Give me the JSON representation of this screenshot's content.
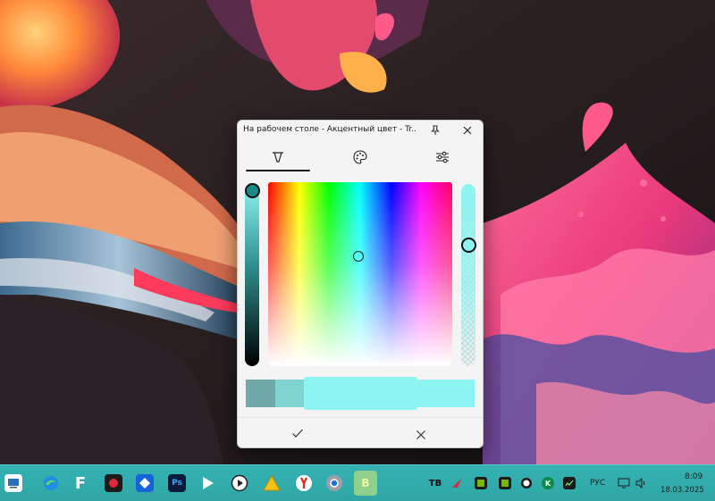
{
  "dialog": {
    "title": "На рабочем столе - Акцентный цвет - Tr...",
    "tabs": [
      {
        "icon": "dropper-icon",
        "selected": true
      },
      {
        "icon": "palette-icon",
        "selected": false
      },
      {
        "icon": "sliders-icon",
        "selected": false
      }
    ],
    "selected_color": "#8ef4f2",
    "swatch_colors": [
      "#6fa8a6",
      "#7fd3d1",
      "#8ef4f2",
      "#8ef4f2"
    ]
  },
  "taskbar": {
    "icons": [
      "desktop-icon",
      "edge-icon",
      "files-icon",
      "screen-recorder-icon",
      "teamviewer-icon",
      "photoshop-icon",
      "media-player-icon",
      "play-icon",
      "arcade-icon",
      "yandex-browser-icon",
      "chrome-icon",
      "green-app-icon"
    ],
    "tray_icons": [
      "tb-icon",
      "red-app-icon",
      "nvidia-icon",
      "green-circle-icon",
      "kaspersky-icon",
      "network-monitor-icon"
    ],
    "language": "РУС",
    "time": "8:09",
    "date": "18.03.2025"
  }
}
